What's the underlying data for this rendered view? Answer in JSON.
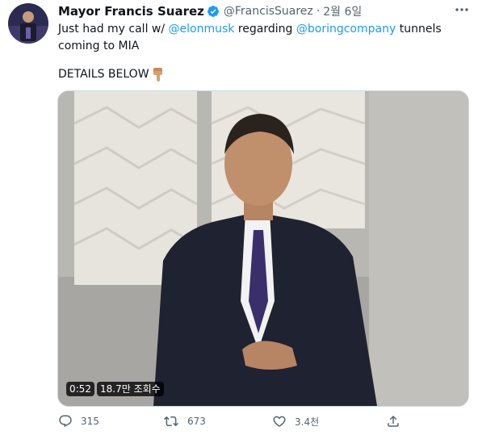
{
  "tweet": {
    "author_name": "Mayor Francis Suarez",
    "handle": "@FrancisSuarez",
    "separator": "·",
    "time": "2월 6일",
    "text_prefix": "Just had my call w/ ",
    "mention_1": "@elonmusk",
    "text_middle": " regarding ",
    "mention_2": "@boringcompany",
    "text_suffix": " tunnels coming to MIA",
    "details": "DETAILS BELOW",
    "details_emoji": "👇",
    "verified": true
  },
  "video": {
    "duration": "0:52",
    "views": "18.7만 조회수"
  },
  "actions": {
    "replies": "315",
    "retweets": "673",
    "likes": "3.4천"
  },
  "colors": {
    "link": "#1d9bf0",
    "secondary_text": "#536471",
    "primary_text": "#0f1419"
  },
  "icons": [
    "verified-badge-icon",
    "more-options-icon",
    "reply-icon",
    "retweet-icon",
    "like-icon",
    "share-icon",
    "pointing-down-emoji"
  ]
}
